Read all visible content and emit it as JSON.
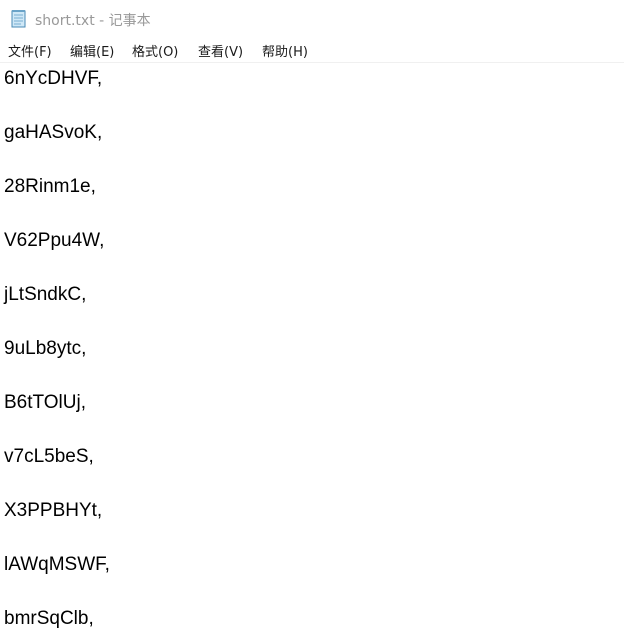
{
  "window": {
    "title": "short.txt - 记事本",
    "app_icon": "notepad-icon"
  },
  "menu": {
    "items": [
      "文件(F)",
      "编辑(E)",
      "格式(O)",
      "查看(V)",
      "帮助(H)"
    ]
  },
  "editor": {
    "lines": [
      "6nYcDHVF,",
      "",
      "gaHASvoK,",
      "",
      "28Rinm1e,",
      "",
      "V62Ppu4W,",
      "",
      "jLtSndkC,",
      "",
      "9uLb8ytc,",
      "",
      "B6tTOlUj,",
      "",
      "v7cL5beS,",
      "",
      "X3PPBHYt,",
      "",
      "lAWqMSWF,",
      "",
      "bmrSqClb,"
    ]
  }
}
